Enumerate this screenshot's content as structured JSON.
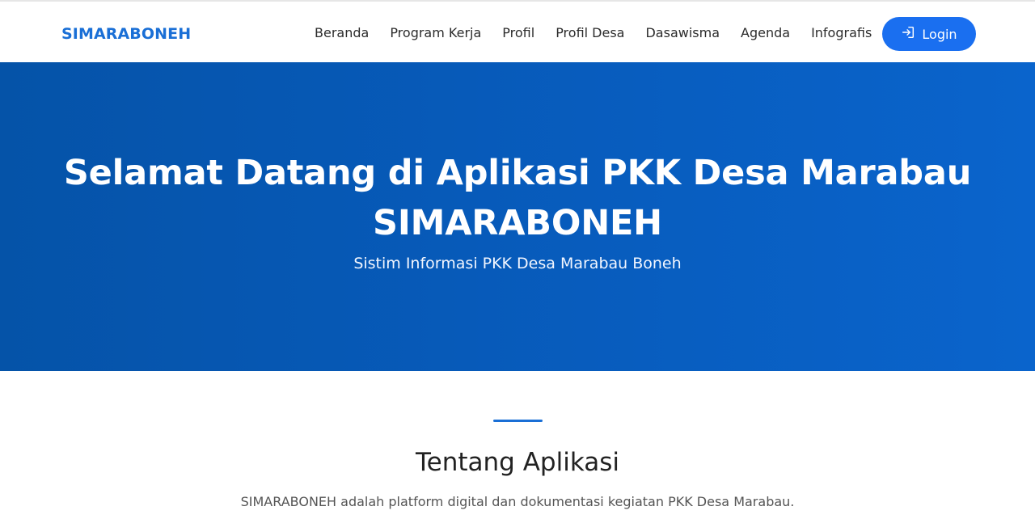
{
  "navbar": {
    "brand": "SIMARABONEH",
    "items": [
      {
        "label": "Beranda"
      },
      {
        "label": "Program Kerja"
      },
      {
        "label": "Profil"
      },
      {
        "label": "Profil Desa"
      },
      {
        "label": "Dasawisma"
      },
      {
        "label": "Agenda"
      },
      {
        "label": "Infografis"
      }
    ],
    "login": {
      "label": "Login",
      "icon": "login-icon"
    }
  },
  "hero": {
    "title_line1": "Selamat Datang di Aplikasi PKK Desa Marabau",
    "title_line2": "SIMARABONEH",
    "subtitle": "Sistim Informasi PKK Desa Marabau Boneh"
  },
  "about": {
    "title": "Tentang Aplikasi",
    "text": "SIMARABONEH adalah platform digital dan dokumentasi kegiatan PKK Desa Marabau."
  },
  "colors": {
    "brand": "#1a6fd6",
    "hero_start": "#0553a8",
    "hero_end": "#0a64cc",
    "button": "#1a6ff0"
  }
}
